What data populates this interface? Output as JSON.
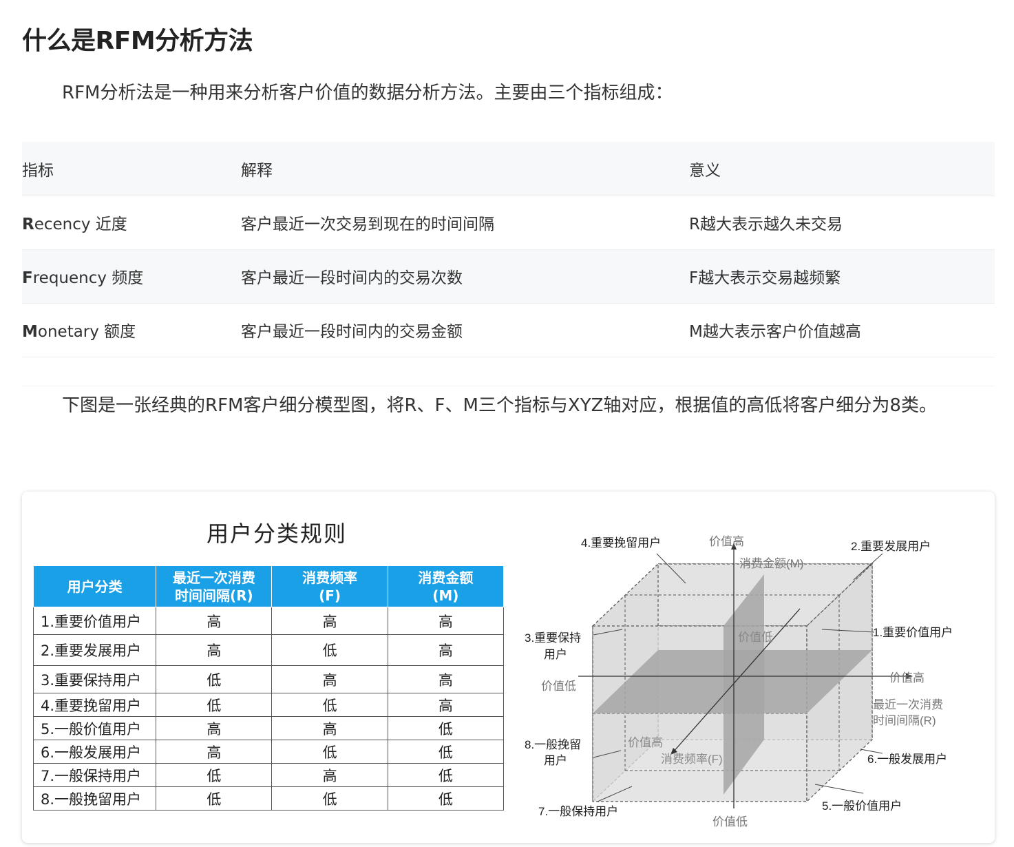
{
  "title": "什么是RFM分析方法",
  "intro": "RFM分析法是一种用来分析客户价值的数据分析方法。主要由三个指标组成：",
  "metrics_table": {
    "headers": [
      "指标",
      "解释",
      "意义"
    ],
    "rows": [
      {
        "initial": "R",
        "rest": "ecency 近度",
        "explanation": "客户最近一次交易到现在的时间间隔",
        "meaning": "R越大表示越久未交易"
      },
      {
        "initial": "F",
        "rest": "requency 频度",
        "explanation": "客户最近一段时间内的交易次数",
        "meaning": "F越大表示交易越频繁"
      },
      {
        "initial": "M",
        "rest": "onetary 额度",
        "explanation": "客户最近一段时间内的交易金额",
        "meaning": "M越大表示客户价值越高"
      }
    ]
  },
  "description": "下图是一张经典的RFM客户细分模型图，将R、F、M三个指标与XYZ轴对应，根据值的高低将客户细分为8类。",
  "figure": {
    "rule_title": "用户分类规则",
    "rule_headers": [
      "用户分类",
      "最近一次消费\n时间间隔(R)",
      "消费频率\n(F)",
      "消费金额\n(M)"
    ],
    "rule_rows": [
      [
        "1.重要价值用户",
        "高",
        "高",
        "高"
      ],
      [
        "2.重要发展用户",
        "高",
        "低",
        "高"
      ],
      [
        "3.重要保持用户",
        "低",
        "高",
        "高"
      ],
      [
        "4.重要挽留用户",
        "低",
        "低",
        "高"
      ],
      [
        "5.一般价值用户",
        "高",
        "高",
        "低"
      ],
      [
        "6.一般发展用户",
        "高",
        "低",
        "低"
      ],
      [
        "7.一般保持用户",
        "低",
        "高",
        "低"
      ],
      [
        "8.一般挽留用户",
        "低",
        "低",
        "低"
      ]
    ],
    "cube": {
      "labels": {
        "seg4": "4.重要挽留用户",
        "seg2": "2.重要发展用户",
        "seg3a": "3.重要保持",
        "seg3b": "用户",
        "seg1": "1.重要价值用户",
        "seg8a": "8.一般挽留",
        "seg8b": "用户",
        "seg6": "6.一般发展用户",
        "seg7": "7.一般保持用户",
        "seg5": "5.一般价值用户",
        "m_high": "价值高",
        "m_axis": "消费金额(M)",
        "m_low": "价值低",
        "r_low": "价值低",
        "r_high": "价值高",
        "r_axis_a": "最近一次消费",
        "r_axis_b": "时间间隔(R)",
        "f_low": "价值低",
        "f_high": "价值高",
        "f_axis": "消费频率(F)"
      }
    }
  }
}
